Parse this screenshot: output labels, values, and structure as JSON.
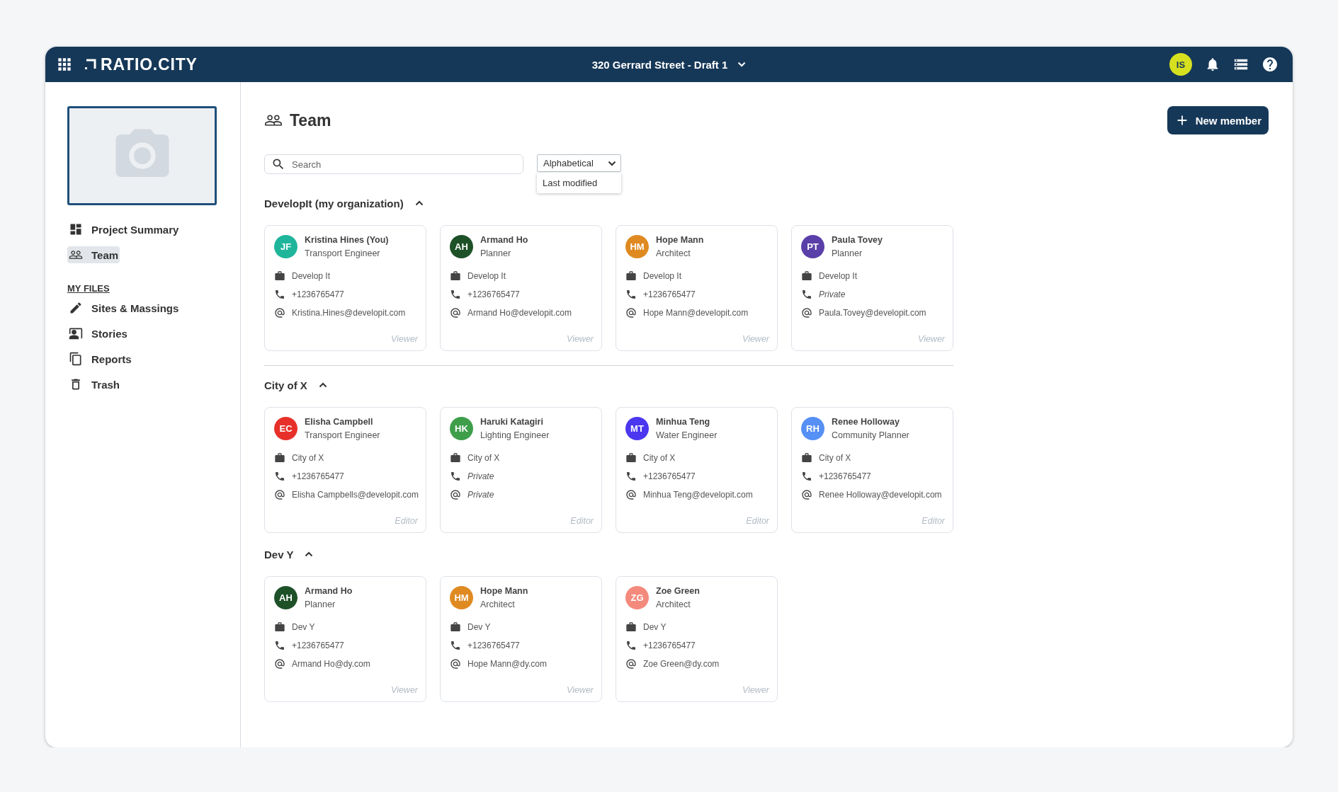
{
  "header": {
    "logo": "RATIO.CITY",
    "project": "320 Gerrard Street - Draft 1",
    "user_initials": "IS"
  },
  "sidebar": {
    "items": [
      {
        "label": "Project Summary",
        "kind": "dashboard",
        "selected": false
      },
      {
        "label": "Team",
        "kind": "team",
        "selected": true
      }
    ],
    "files_heading": "MY FILES",
    "files": [
      {
        "label": "Sites & Massings",
        "kind": "sites",
        "selected": false
      },
      {
        "label": "Stories",
        "kind": "stories",
        "selected": false
      },
      {
        "label": "Reports",
        "kind": "reports",
        "selected": false
      },
      {
        "label": "Trash",
        "kind": "trash",
        "selected": false
      }
    ]
  },
  "page": {
    "title": "Team",
    "new_button": "New member"
  },
  "search": {
    "placeholder": "Search"
  },
  "sort": {
    "value": "Alphabetical",
    "expanded": true,
    "options": [
      "Last modified"
    ]
  },
  "sections": [
    {
      "title": "DevelopIt (my organization)",
      "expanded": true,
      "members": [
        {
          "initials": "JF",
          "color": "#1fb59b",
          "name": "Kristina Hines (You)",
          "role": "Transport Engineer",
          "org": "Develop It",
          "phone": "+1236765477",
          "phone_private": false,
          "email": "Kristina.Hines@developit.com",
          "email_private": false,
          "access": "Viewer"
        },
        {
          "initials": "AH",
          "color": "#1e5128",
          "name": "Armand Ho",
          "role": "Planner",
          "org": "Develop It",
          "phone": "+1236765477",
          "phone_private": false,
          "email": "Armand Ho@developit.com",
          "email_private": false,
          "access": "Viewer"
        },
        {
          "initials": "HM",
          "color": "#df8a21",
          "name": "Hope Mann",
          "role": "Architect",
          "org": "Develop It",
          "phone": "+1236765477",
          "phone_private": false,
          "email": "Hope Mann@developit.com",
          "email_private": false,
          "access": "Viewer"
        },
        {
          "initials": "PT",
          "color": "#5a3fa8",
          "name": "Paula Tovey",
          "role": "Planner",
          "org": "Develop It",
          "phone": "Private",
          "phone_private": true,
          "email": "Paula.Tovey@developit.com",
          "email_private": false,
          "access": "Viewer"
        }
      ]
    },
    {
      "title": "City of X",
      "expanded": true,
      "members": [
        {
          "initials": "EC",
          "color": "#e8302a",
          "name": "Elisha Campbell",
          "role": "Transport Engineer",
          "org": "City of X",
          "phone": "+1236765477",
          "phone_private": false,
          "email": "Elisha Campbells@developit.com",
          "email_private": false,
          "access": "Editor"
        },
        {
          "initials": "HK",
          "color": "#3e9e4a",
          "name": "Haruki Katagiri",
          "role": "Lighting Engineer",
          "org": "City of X",
          "phone": "Private",
          "phone_private": true,
          "email": "Private",
          "email_private": true,
          "access": "Editor"
        },
        {
          "initials": "MT",
          "color": "#4a37ef",
          "name": "Minhua Teng",
          "role": "Water Engineer",
          "org": "City of X",
          "phone": "+1236765477",
          "phone_private": false,
          "email": "Minhua Teng@developit.com",
          "email_private": false,
          "access": "Editor"
        },
        {
          "initials": "RH",
          "color": "#5690f5",
          "name": "Renee Holloway",
          "role": "Community Planner",
          "org": "City of X",
          "phone": "+1236765477",
          "phone_private": false,
          "email": "Renee Holloway@developit.com",
          "email_private": false,
          "access": "Editor"
        }
      ]
    },
    {
      "title": "Dev Y",
      "expanded": true,
      "members": [
        {
          "initials": "AH",
          "color": "#1e5128",
          "name": "Armand Ho",
          "role": "Planner",
          "org": "Dev Y",
          "phone": "+1236765477",
          "phone_private": false,
          "email": "Armand Ho@dy.com",
          "email_private": false,
          "access": "Viewer"
        },
        {
          "initials": "HM",
          "color": "#df8a21",
          "name": "Hope Mann",
          "role": "Architect",
          "org": "Dev Y",
          "phone": "+1236765477",
          "phone_private": false,
          "email": "Hope Mann@dy.com",
          "email_private": false,
          "access": "Viewer"
        },
        {
          "initials": "ZG",
          "color": "#f48a7c",
          "name": "Zoe Green",
          "role": "Architect",
          "org": "Dev Y",
          "phone": "+1236765477",
          "phone_private": false,
          "email": "Zoe Green@dy.com",
          "email_private": false,
          "access": "Viewer"
        }
      ]
    }
  ]
}
